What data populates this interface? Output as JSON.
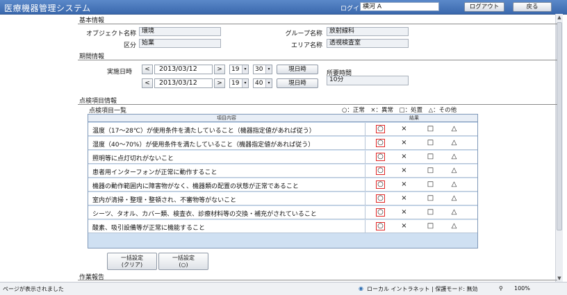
{
  "header": {
    "title": "医療機器管理システム",
    "login_label": "ログイン",
    "login_value": "横河 A",
    "logout_label": "ログアウト",
    "back_label": "戻る"
  },
  "basic": {
    "section": "基本情報",
    "object_label": "オブジェクト名称",
    "object_value": "環境",
    "category_label": "区分",
    "category_value": "始業",
    "group_label": "グループ名称",
    "group_value": "放射線科",
    "area_label": "エリア名称",
    "area_value": "透視検査室"
  },
  "period": {
    "section": "期間情報",
    "exec_label": "実施日時",
    "start_date": "2013/03/12",
    "start_hour": "19",
    "start_min": "30",
    "end_date": "2013/03/12",
    "end_hour": "19",
    "end_min": "40",
    "now_label": "現日時",
    "duration_label": "所要時間",
    "duration_value": "10分",
    "prev": "<",
    "next": ">",
    "dropdown_arrow": "▾"
  },
  "inspection": {
    "section": "点検項目情報",
    "list_title": "点検項目一覧",
    "legend": "○：正常　×：異常　□：処置　△：その他",
    "col_content": "項目内容",
    "col_result": "結果",
    "symbols": {
      "normal": "○",
      "abnormal": "×",
      "treated": "□",
      "other": "△"
    },
    "rows": [
      {
        "text": "温度（17～28℃）が使用条件を満たしていること（機器指定値があれば従う）"
      },
      {
        "text": "湿度（40～70%）が使用条件を満たしていること（機器指定値があれば従う）"
      },
      {
        "text": "照明等に点灯切れがないこと"
      },
      {
        "text": "患者用インターフォンが正常に動作すること"
      },
      {
        "text": "機器の動作範囲内に障害物がなく、機器類の配置の状態が正常であること"
      },
      {
        "text": "室内が清掃・整理・整頓され、不審物等がないこと"
      },
      {
        "text": "シーツ、タオル、カバー類、検査衣、診療材料等の交換・補充がされていること"
      },
      {
        "text": "酸素、吸引設備等が正常に機能すること"
      }
    ],
    "bulk_clear_line1": "一括設定",
    "bulk_clear_line2": "(クリア)",
    "bulk_ok_line1": "一括設定",
    "bulk_ok_line2": "(○)"
  },
  "work": {
    "section": "作業報告"
  },
  "statusbar": {
    "left": "ページが表示されました",
    "zone": "ローカル イントラネット | 保護モード: 無効",
    "zoom": "100%",
    "zone_icon": "globe-icon",
    "zoom_icon": "magnifier-icon"
  },
  "colors": {
    "header": "#3a68ad",
    "table_bg": "#cfe0f2",
    "selected_mark": "#e02424"
  }
}
